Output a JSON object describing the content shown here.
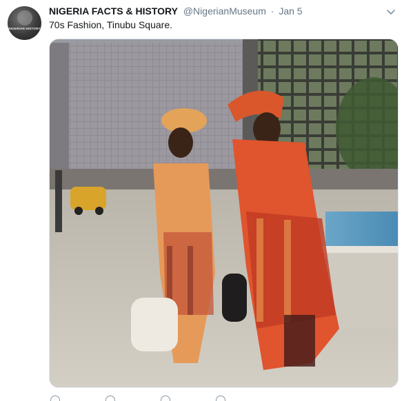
{
  "tweet": {
    "author": {
      "display_name": "NIGERIA FACTS & HISTORY",
      "handle": "@NigerianMuseum",
      "separator": "·",
      "timestamp": "Jan 5",
      "avatar_text": "NIGERIAN HISTORY"
    },
    "text": "70s Fashion, Tinubu Square.",
    "media": {
      "description_icon": "photo"
    },
    "icons": {
      "more": "chevron-down-icon",
      "reply": "reply-icon",
      "retweet": "retweet-icon",
      "like": "heart-icon",
      "dm": "envelope-icon"
    },
    "colors": {
      "name": "#14171a",
      "secondary": "#657786",
      "border": "#e1e8ed",
      "icon": "#8899a6"
    }
  }
}
